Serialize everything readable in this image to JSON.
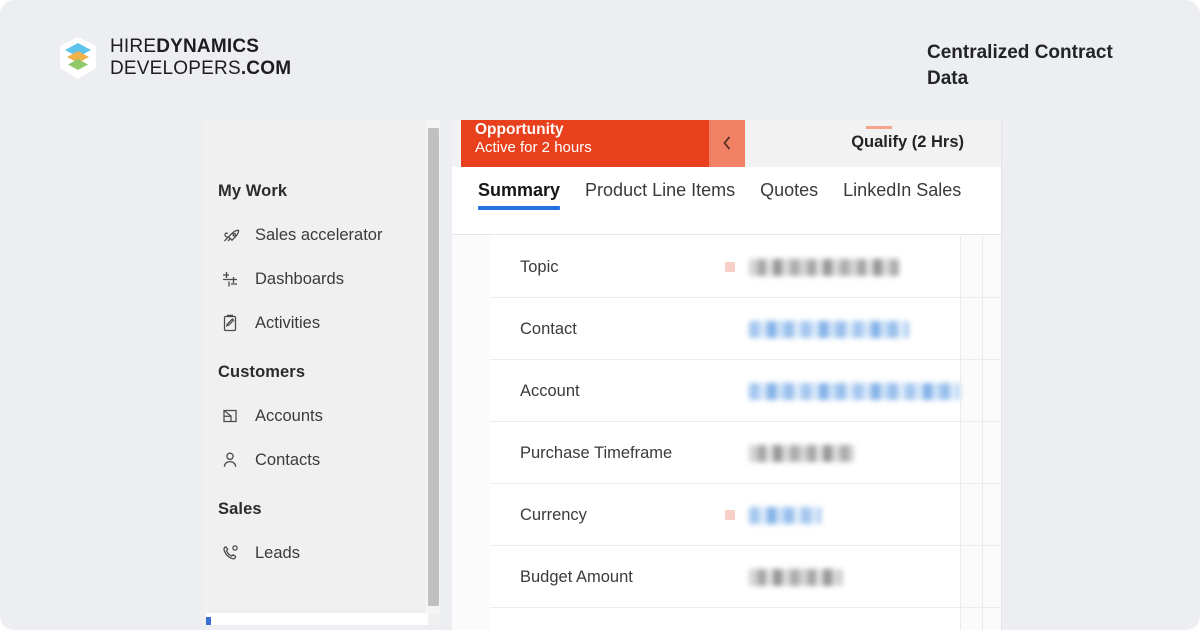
{
  "brand": {
    "logo_icon": "layered-stack-logo",
    "logo_colors": [
      "#5ec2ea",
      "#f0b24a",
      "#8fc96a"
    ],
    "line1_light": "HIRE",
    "line1_bold": "DYNAMICS",
    "line2_light": "DEVELOPERS",
    "line2_bold": ".COM"
  },
  "headline": {
    "text": "Centralized Contract Data"
  },
  "sidebar": {
    "groups": [
      {
        "title": "My Work",
        "items": [
          {
            "label": "Sales accelerator",
            "icon": "rocket-icon"
          },
          {
            "label": "Dashboards",
            "icon": "dashboard-icon"
          },
          {
            "label": "Activities",
            "icon": "clipboard-icon"
          }
        ]
      },
      {
        "title": "Customers",
        "items": [
          {
            "label": "Accounts",
            "icon": "building-icon"
          },
          {
            "label": "Contacts",
            "icon": "person-icon"
          }
        ]
      },
      {
        "title": "Sales",
        "items": [
          {
            "label": "Leads",
            "icon": "phone-icon"
          }
        ]
      }
    ]
  },
  "process_bar": {
    "stage_title": "Opportunity",
    "stage_subtitle": "Active for 2 hours",
    "collapse_icon": "chevron-left-icon",
    "next_stage": "Qualify",
    "next_duration": "(2 Hrs)",
    "accent_color": "#e8401c",
    "collapse_color": "#f08164"
  },
  "tabs": [
    {
      "label": "Summary",
      "active": true
    },
    {
      "label": "Product Line Items",
      "active": false
    },
    {
      "label": "Quotes",
      "active": false
    },
    {
      "label": "LinkedIn Sales",
      "active": false
    }
  ],
  "active_tab_color": "#2372e0",
  "form": {
    "fields": [
      {
        "label": "Topic",
        "required": true,
        "value_style": "gray",
        "value_width": 150,
        "value": ""
      },
      {
        "label": "Contact",
        "required": false,
        "value_style": "blue",
        "value_width": 160,
        "value": ""
      },
      {
        "label": "Account",
        "required": false,
        "value_style": "blue",
        "value_width": 220,
        "value": ""
      },
      {
        "label": "Purchase Timeframe",
        "required": false,
        "value_style": "gray",
        "value_width": 105,
        "value": ""
      },
      {
        "label": "Currency",
        "required": true,
        "value_style": "blue",
        "value_width": 72,
        "value": ""
      },
      {
        "label": "Budget Amount",
        "required": false,
        "value_style": "gray",
        "value_width": 93,
        "value": ""
      }
    ]
  }
}
